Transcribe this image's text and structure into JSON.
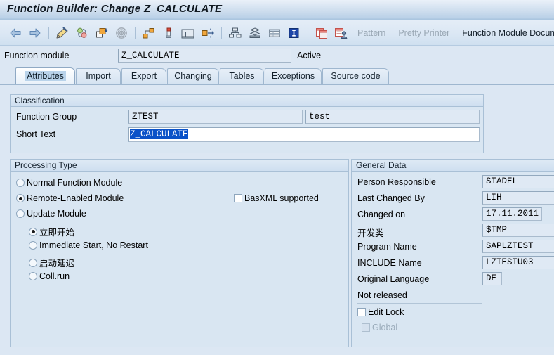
{
  "window": {
    "title": "Function Builder: Change Z_CALCULATE"
  },
  "toolbar": {
    "icons": [
      {
        "name": "back-arrow-icon",
        "label": "Back"
      },
      {
        "name": "forward-arrow-icon",
        "label": "Forward"
      },
      {
        "name": "display-change-pencil-icon",
        "label": "Display <-> Change"
      },
      {
        "name": "check-syntax-icon",
        "label": "Check"
      },
      {
        "name": "activate-icon",
        "label": "Activate"
      },
      {
        "name": "where-used-list-icon",
        "label": "Where-Used List"
      },
      {
        "name": "object-navigator-icon",
        "label": "Other Object"
      },
      {
        "name": "single-test-icon",
        "label": "Single Test"
      },
      {
        "name": "display-object-list-icon",
        "label": "Display Object List"
      },
      {
        "name": "release-icon",
        "label": "Release"
      },
      {
        "name": "hierarchy-icon",
        "label": "Hierarchy"
      },
      {
        "name": "stack-icon",
        "label": "Stack"
      },
      {
        "name": "table-view-icon",
        "label": "Table View"
      },
      {
        "name": "information-icon",
        "label": "Information"
      },
      {
        "name": "copy-icon",
        "label": "Copy"
      },
      {
        "name": "copy-user-icon",
        "label": "Copy User"
      }
    ],
    "pattern_label": "Pattern",
    "pretty_printer_label": "Pretty Printer",
    "function_module_documentation_label": "Function Module Documentation"
  },
  "function_module": {
    "label": "Function module",
    "value": "Z_CALCULATE",
    "status": "Active"
  },
  "tabs": [
    {
      "label": "Attributes",
      "active": true
    },
    {
      "label": "Import",
      "active": false
    },
    {
      "label": "Export",
      "active": false
    },
    {
      "label": "Changing",
      "active": false
    },
    {
      "label": "Tables",
      "active": false
    },
    {
      "label": "Exceptions",
      "active": false
    },
    {
      "label": "Source code",
      "active": false
    }
  ],
  "classification": {
    "title": "Classification",
    "function_group_label": "Function Group",
    "function_group_value": "ZTEST",
    "function_group_text": "test",
    "short_text_label": "Short Text",
    "short_text_value": "Z_CALCULATE"
  },
  "processing_type": {
    "title": "Processing Type",
    "options": [
      {
        "label": "Normal Function Module",
        "selected": false
      },
      {
        "label": "Remote-Enabled Module",
        "selected": true
      },
      {
        "label": "Update Module",
        "selected": false
      }
    ],
    "basxml_label": "BasXML supported",
    "basxml_checked": false,
    "update_options": [
      {
        "label": "立即开始",
        "selected": true
      },
      {
        "label": "Immediate Start, No Restart",
        "selected": false
      },
      {
        "label": "启动延迟",
        "selected": false
      },
      {
        "label": "Coll.run",
        "selected": false
      }
    ]
  },
  "general_data": {
    "title": "General Data",
    "rows": [
      {
        "label": "Person Responsible",
        "value": "STADEL"
      },
      {
        "label": "Last Changed By",
        "value": "LIH"
      },
      {
        "label": "Changed on",
        "value": "17.11.2011"
      },
      {
        "label": "开发类",
        "value": "$TMP"
      },
      {
        "label": "Program Name",
        "value": "SAPLZTEST"
      },
      {
        "label": "INCLUDE Name",
        "value": "LZTESTU03"
      },
      {
        "label": "Original Language",
        "value": "DE"
      }
    ],
    "release_status": "Not released",
    "edit_lock_label": "Edit Lock",
    "edit_lock_checked": false,
    "global_label": "Global",
    "global_checked": false,
    "global_disabled": true
  },
  "colors": {
    "background": "#dce7f3",
    "panel": "#d9e6f2",
    "panel_border": "#a9c0d6",
    "field_bg": "#dfe9f4",
    "selection_blue": "#0a52c8",
    "disabled_text": "#9aa8b5"
  }
}
